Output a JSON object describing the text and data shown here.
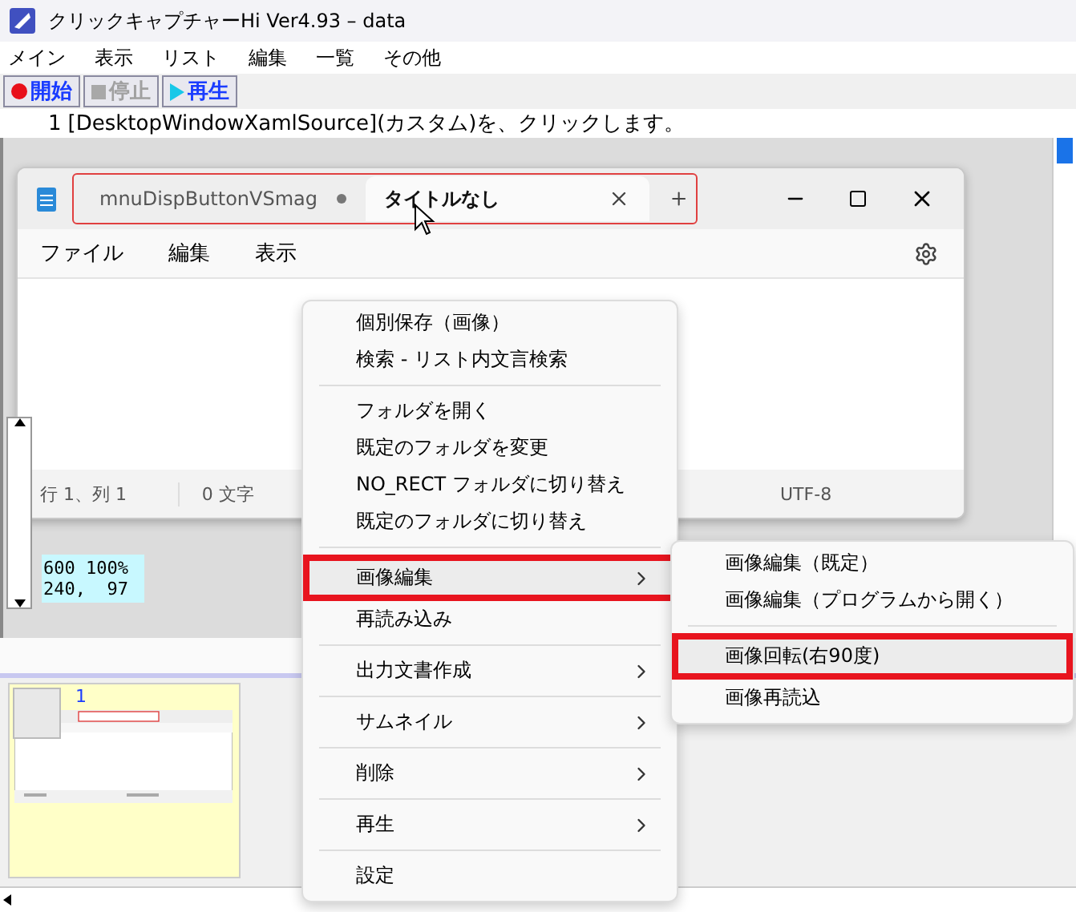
{
  "window": {
    "title": "クリックキャプチャーHi Ver4.93 – data"
  },
  "menu_bar": [
    "メイン",
    "表示",
    "リスト",
    "編集",
    "一覧",
    "その他"
  ],
  "toolbar": [
    {
      "label": "開始",
      "kind": "record",
      "disabled": false
    },
    {
      "label": "停止",
      "kind": "stop",
      "disabled": true
    },
    {
      "label": "再生",
      "kind": "play",
      "disabled": false
    }
  ],
  "step": {
    "number": "1",
    "text": "[DesktopWindowXamlSource](カスタム)を、クリックします。"
  },
  "captured_window": {
    "tabs_highlighted": true,
    "tabs": [
      {
        "label": "mnuDispButtonVSmag",
        "selected": false
      },
      {
        "label": "タイトルなし",
        "selected": true
      }
    ],
    "menu": [
      "ファイル",
      "編集",
      "表示"
    ],
    "status_bar": [
      "行 1、列 1",
      "0 文字",
      "UTF-8"
    ]
  },
  "info": [
    "600 100%",
    "240,  97"
  ],
  "thumbnails": [
    {
      "number": "1"
    }
  ],
  "context_menu": {
    "groups": [
      [
        {
          "label": "個別保存（画像）",
          "kind": "item",
          "highlighted": false
        },
        {
          "label": "検索 - リスト内文言検索",
          "kind": "item",
          "highlighted": false
        }
      ],
      [
        {
          "label": "フォルダを開く",
          "kind": "item",
          "highlighted": false
        },
        {
          "label": "既定のフォルダを変更",
          "kind": "item",
          "highlighted": false
        },
        {
          "label": "NO_RECT フォルダに切り替え",
          "kind": "item",
          "highlighted": false
        },
        {
          "label": "既定のフォルダに切り替え",
          "kind": "item",
          "highlighted": false
        }
      ],
      [
        {
          "label": "画像編集",
          "kind": "submenu",
          "highlighted": true
        },
        {
          "label": "再読み込み",
          "kind": "item",
          "highlighted": false
        }
      ],
      [
        {
          "label": "出力文書作成",
          "kind": "submenu",
          "highlighted": false
        }
      ],
      [
        {
          "label": "サムネイル",
          "kind": "submenu",
          "highlighted": false
        }
      ],
      [
        {
          "label": "削除",
          "kind": "submenu",
          "highlighted": false
        }
      ],
      [
        {
          "label": "再生",
          "kind": "submenu",
          "highlighted": false
        }
      ],
      [
        {
          "label": "設定",
          "kind": "item",
          "highlighted": false
        }
      ]
    ]
  },
  "submenu": {
    "groups": [
      [
        {
          "label": "画像編集（既定）",
          "highlighted": false
        },
        {
          "label": "画像編集（プログラムから開く）",
          "highlighted": false
        }
      ],
      [
        {
          "label": "画像回転(右90度)",
          "highlighted": true
        },
        {
          "label": "画像再読込",
          "highlighted": false
        }
      ]
    ]
  }
}
